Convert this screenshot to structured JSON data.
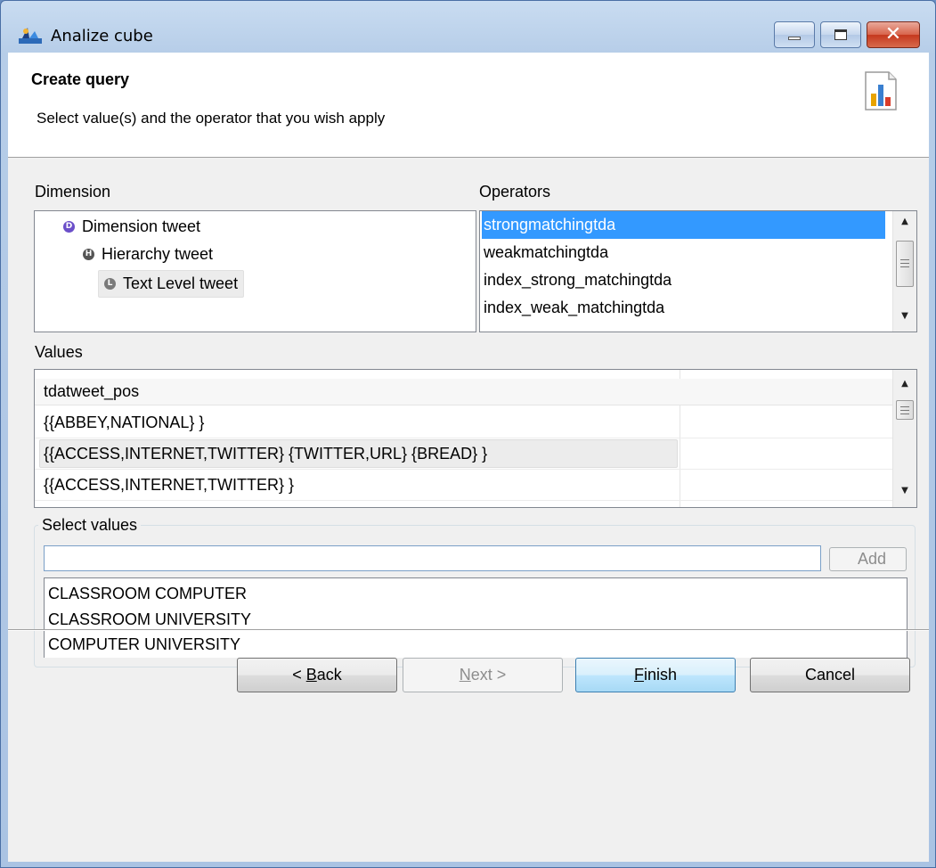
{
  "window": {
    "title": "Analize cube"
  },
  "header": {
    "title": "Create query",
    "description": "Select value(s) and the operator that you wish apply",
    "icon": "chart-icon"
  },
  "dimension": {
    "label": "Dimension",
    "tree": [
      {
        "icon": "dimension-icon",
        "badge": "D",
        "label": "Dimension tweet"
      },
      {
        "icon": "hierarchy-icon",
        "badge": "H",
        "label": "Hierarchy tweet"
      },
      {
        "icon": "level-icon",
        "badge": "L",
        "label": "Text Level tweet"
      }
    ]
  },
  "operators": {
    "label": "Operators",
    "items": [
      "strongmatchingtda",
      "weakmatchingtda",
      "index_strong_matchingtda",
      "index_weak_matchingtda"
    ],
    "selected": "strongmatchingtda"
  },
  "values": {
    "label": "Values",
    "column_header": "tdatweet_pos",
    "rows": [
      "{{ABBEY,NATIONAL} }",
      "{{ACCESS,INTERNET,TWITTER} {TWITTER,URL} {BREAD} }",
      "{{ACCESS,INTERNET,TWITTER} }"
    ]
  },
  "select_values": {
    "label": "Select values",
    "input_value": "",
    "add_label": "Add",
    "items": [
      "CLASSROOM COMPUTER",
      "CLASSROOM UNIVERSITY",
      "COMPUTER UNIVERSITY"
    ]
  },
  "footer": {
    "back_pre": "< ",
    "back_key": "B",
    "back_post": "ack",
    "next_key": "N",
    "next_post": "ext >",
    "finish_key": "F",
    "finish_post": "inish",
    "cancel": "Cancel"
  },
  "colors": {
    "selection": "#3399ff",
    "finish_border": "#3c7fb1",
    "close_button": "#c5381e"
  }
}
